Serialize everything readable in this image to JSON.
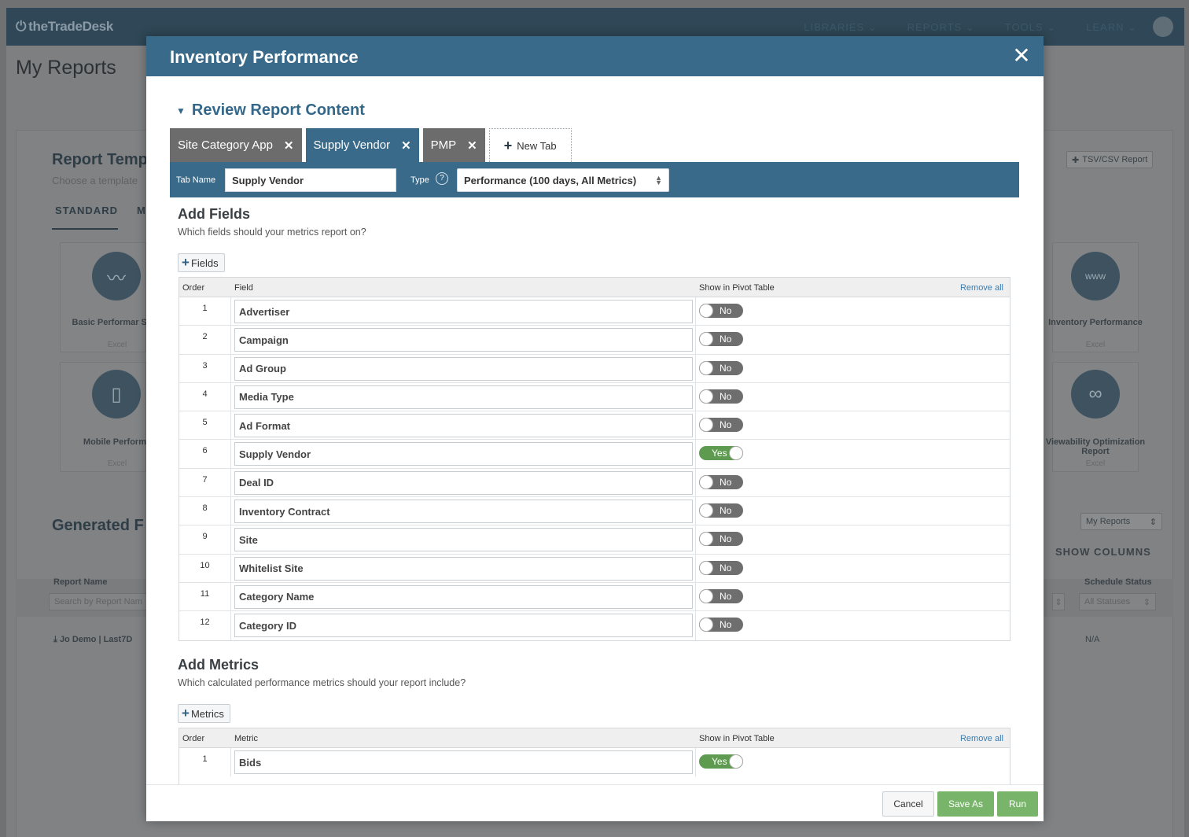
{
  "nav": {
    "logo": "theTradeDesk",
    "items": [
      "LIBRARIES ⌄",
      "REPORTS ⌄",
      "TOOLS ⌄",
      "LEARN ⌄"
    ]
  },
  "background": {
    "page_title": "My Reports",
    "templates_title": "Report Temp",
    "templates_sub": "Choose a template",
    "tab_standard": "STANDARD",
    "tab_m": "M",
    "tsv_button": "TSV/CSV Report",
    "cards": [
      {
        "label": "Basic Performar Stats",
        "sub": "Excel"
      },
      {
        "label": "Mobile Performa",
        "sub": "Excel"
      },
      {
        "label": "Inventory Performance",
        "sub": "Excel"
      },
      {
        "label": "Viewability Optimization Report",
        "sub": "Excel"
      }
    ],
    "generated_title": "Generated F",
    "my_reports_select": "My Reports",
    "show_columns": "SHOW COLUMNS",
    "col_report_name": "Report Name",
    "search_placeholder": "Search by Report Nam",
    "col_schedule_status": "Schedule Status",
    "status_select": "All Statuses",
    "row_name": "Jo Demo | Last7D",
    "row_status": "N/A"
  },
  "modal": {
    "title": "Inventory Performance",
    "section_title": "Review Report Content",
    "tabs": [
      {
        "label": "Site Category App",
        "active": false
      },
      {
        "label": "Supply Vendor",
        "active": true
      },
      {
        "label": "PMP",
        "active": false
      }
    ],
    "new_tab": "New Tab",
    "tab_name_label": "Tab Name",
    "tab_name_value": "Supply Vendor",
    "type_label": "Type",
    "type_value": "Performance (100 days, All Metrics)"
  },
  "fields": {
    "title": "Add Fields",
    "description": "Which fields should your metrics report on?",
    "add_button": "Fields",
    "col_order": "Order",
    "col_field": "Field",
    "col_pivot": "Show in Pivot Table",
    "remove_all": "Remove all",
    "rows": [
      {
        "order": "1",
        "name": "Advertiser",
        "pivot": "No"
      },
      {
        "order": "2",
        "name": "Campaign",
        "pivot": "No"
      },
      {
        "order": "3",
        "name": "Ad Group",
        "pivot": "No"
      },
      {
        "order": "4",
        "name": "Media Type",
        "pivot": "No"
      },
      {
        "order": "5",
        "name": "Ad Format",
        "pivot": "No"
      },
      {
        "order": "6",
        "name": "Supply Vendor",
        "pivot": "Yes"
      },
      {
        "order": "7",
        "name": "Deal ID",
        "pivot": "No"
      },
      {
        "order": "8",
        "name": "Inventory Contract",
        "pivot": "No"
      },
      {
        "order": "9",
        "name": "Site",
        "pivot": "No"
      },
      {
        "order": "10",
        "name": "Whitelist Site",
        "pivot": "No"
      },
      {
        "order": "11",
        "name": "Category Name",
        "pivot": "No"
      },
      {
        "order": "12",
        "name": "Category ID",
        "pivot": "No"
      }
    ]
  },
  "metrics": {
    "title": "Add Metrics",
    "description": "Which calculated performance metrics should your report include?",
    "add_button": "Metrics",
    "col_order": "Order",
    "col_metric": "Metric",
    "col_pivot": "Show in Pivot Table",
    "remove_all": "Remove all",
    "rows": [
      {
        "order": "1",
        "name": "Bids",
        "pivot": "Yes"
      }
    ]
  },
  "footer": {
    "cancel": "Cancel",
    "save_as": "Save As",
    "run": "Run"
  },
  "colors": {
    "header_blue": "#3a6a8a",
    "toggle_on": "#5e9a4f",
    "toggle_off": "#6e6e6e",
    "button_green": "#78b46a",
    "link_blue": "#3a7db0"
  }
}
